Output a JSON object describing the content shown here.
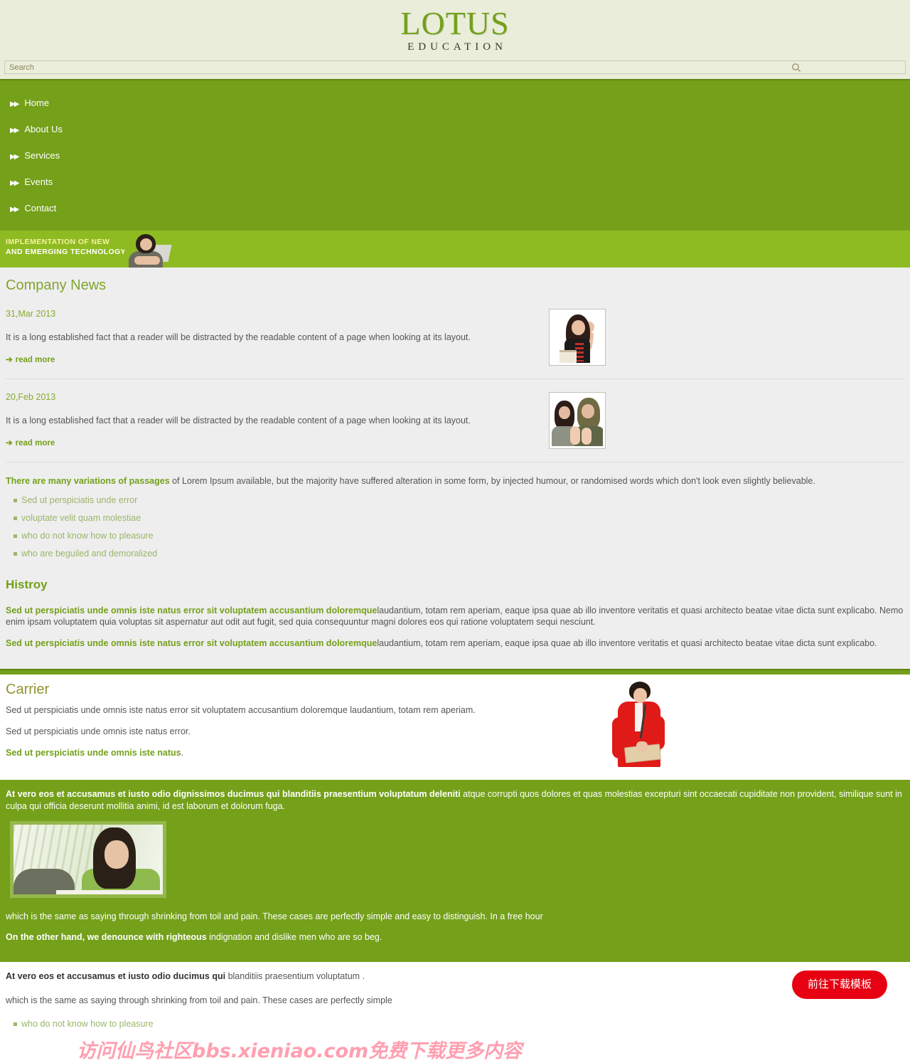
{
  "colors": {
    "brand_green": "#74a01a",
    "banner_green": "#8fbb22",
    "header_bg": "#e9edd9",
    "section_gray": "#eeeeee",
    "accent_red": "#e60012",
    "list_green": "#9cb56a",
    "olive_title": "#91942f"
  },
  "header": {
    "logo_main": "LOTUS",
    "logo_sub": "EDUCATION"
  },
  "search": {
    "placeholder": "Search",
    "value": "",
    "icon": "search-icon"
  },
  "nav": {
    "bullet": "▶▶",
    "items": [
      {
        "label": "Home"
      },
      {
        "label": "About Us"
      },
      {
        "label": "Services"
      },
      {
        "label": "Events"
      },
      {
        "label": "Contact"
      }
    ]
  },
  "banner": {
    "line1": "IMPLEMENTATION OF NEW",
    "line2": "AND EMERGING TECHNOLOGY",
    "image_alt": "woman-with-laptop-photo"
  },
  "news": {
    "title": "Company News",
    "items": [
      {
        "date": "31,Mar 2013",
        "body": "It is a long established fact that a reader will be distracted by the readable content of a page when looking at its layout.",
        "read_more": "read more",
        "read_more_arrow": "➔",
        "image_alt": "woman-holding-books-photo"
      },
      {
        "date": "20,Feb 2013",
        "body": "It is a long established fact that a reader will be distracted by the readable content of a page when looking at its layout.",
        "read_more": "read more",
        "read_more_arrow": "➔",
        "image_alt": "two-women-thumbs-up-photo"
      }
    ],
    "lead_bold": "There are many variations of passages",
    "lead_rest": " of Lorem Ipsum available, but the majority have suffered alteration in some form, by injected humour, or randomised words which don't look even slightly believable.",
    "bullets": [
      "Sed ut perspiciatis unde error",
      "voluptate velit quam molestiae",
      "who do not know how to pleasure",
      "who are beguiled and demoralized"
    ]
  },
  "history": {
    "title": "Histroy",
    "paragraphs": [
      {
        "bold": "Sed ut perspiciatis unde omnis iste natus error sit voluptatem accusantium doloremque",
        "rest": "laudantium, totam rem aperiam, eaque ipsa quae ab illo inventore veritatis et quasi architecto beatae vitae dicta sunt explicabo. Nemo enim ipsam voluptatem quia voluptas sit aspernatur aut odit aut fugit, sed quia consequuntur magni dolores eos qui ratione voluptatem sequi nesciunt."
      },
      {
        "bold": "Sed ut perspiciatis unde omnis iste natus error sit voluptatem accusantium doloremque",
        "rest": "laudantium, totam rem aperiam, eaque ipsa quae ab illo inventore veritatis et quasi architecto beatae vitae dicta sunt explicabo."
      }
    ]
  },
  "carrier": {
    "title": "Carrier",
    "para1": "Sed ut perspiciatis unde omnis iste natus error sit voluptatem accusantium doloremque laudantium, totam rem aperiam.",
    "para2": "Sed ut perspiciatis unde omnis iste natus error.",
    "para3_bold": "Sed ut perspiciatis unde omnis iste natus",
    "para3_rest": ".",
    "image_alt": "woman-in-red-blazer-reading-photo"
  },
  "green_block": {
    "para1_bold": "At vero eos et accusamus et iusto odio dignissimos ducimus qui blanditiis praesentium voluptatum deleniti",
    "para1_rest": " atque corrupti quos dolores et quas molestias excepturi sint occaecati cupiditate non provident, similique sunt in culpa qui officia deserunt mollitia animi, id est laborum et dolorum fuga.",
    "image_alt": "student-reading-at-window-photo",
    "para2": "which is the same as saying through shrinking from toil and pain. These cases are perfectly simple and easy to distinguish. In a free hour",
    "para3_bold": "On the other hand, we denounce with righteous",
    "para3_rest": " indignation and dislike men who are so beg."
  },
  "bottom": {
    "para1_bold": "At vero eos et accusamus et iusto odio ducimus qui",
    "para1_rest": " blanditiis praesentium voluptatum .",
    "para2": "which is the same as saying through shrinking from toil and pain. These cases are perfectly simple",
    "bullets": [
      "who do not know how to pleasure"
    ],
    "download_button": "前往下载模板"
  },
  "watermark": {
    "text": "访问仙鸟社区bbs.xieniao.com免费下载更多内容"
  }
}
